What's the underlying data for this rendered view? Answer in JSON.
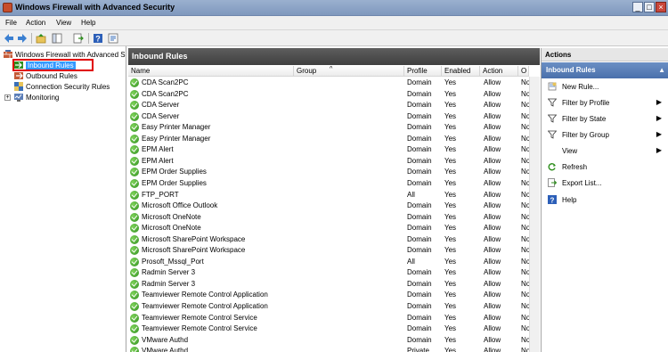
{
  "window": {
    "title": "Windows Firewall with Advanced Security"
  },
  "menu": [
    "File",
    "Action",
    "View",
    "Help"
  ],
  "toolbar": {
    "buttons": [
      "back-icon",
      "forward-icon",
      "up-folder-icon",
      "show-hide-tree-icon",
      "export-list-icon",
      "help-icon",
      "properties-icon"
    ]
  },
  "tree": {
    "root": "Windows Firewall with Advanced S",
    "items": [
      {
        "label": "Inbound Rules",
        "icon": "inbound-rules-icon",
        "selected": true
      },
      {
        "label": "Outbound Rules",
        "icon": "outbound-rules-icon"
      },
      {
        "label": "Connection Security Rules",
        "icon": "connection-security-icon"
      },
      {
        "label": "Monitoring",
        "icon": "monitoring-icon"
      }
    ]
  },
  "center": {
    "title": "Inbound Rules",
    "columns": [
      "Name",
      "Group",
      "Profile",
      "Enabled",
      "Action",
      "O"
    ],
    "rows": [
      {
        "name": "CDA Scan2PC",
        "profile": "Domain",
        "enabled": "Yes",
        "action": "Allow",
        "override": "No"
      },
      {
        "name": "CDA Scan2PC",
        "profile": "Domain",
        "enabled": "Yes",
        "action": "Allow",
        "override": "No"
      },
      {
        "name": "CDA Server",
        "profile": "Domain",
        "enabled": "Yes",
        "action": "Allow",
        "override": "No"
      },
      {
        "name": "CDA Server",
        "profile": "Domain",
        "enabled": "Yes",
        "action": "Allow",
        "override": "No"
      },
      {
        "name": "Easy Printer Manager",
        "profile": "Domain",
        "enabled": "Yes",
        "action": "Allow",
        "override": "No"
      },
      {
        "name": "Easy Printer Manager",
        "profile": "Domain",
        "enabled": "Yes",
        "action": "Allow",
        "override": "No"
      },
      {
        "name": "EPM Alert",
        "profile": "Domain",
        "enabled": "Yes",
        "action": "Allow",
        "override": "No"
      },
      {
        "name": "EPM Alert",
        "profile": "Domain",
        "enabled": "Yes",
        "action": "Allow",
        "override": "No"
      },
      {
        "name": "EPM Order Supplies",
        "profile": "Domain",
        "enabled": "Yes",
        "action": "Allow",
        "override": "No"
      },
      {
        "name": "EPM Order Supplies",
        "profile": "Domain",
        "enabled": "Yes",
        "action": "Allow",
        "override": "No"
      },
      {
        "name": "FTP_PORT",
        "profile": "All",
        "enabled": "Yes",
        "action": "Allow",
        "override": "No"
      },
      {
        "name": "Microsoft Office Outlook",
        "profile": "Domain",
        "enabled": "Yes",
        "action": "Allow",
        "override": "No"
      },
      {
        "name": "Microsoft OneNote",
        "profile": "Domain",
        "enabled": "Yes",
        "action": "Allow",
        "override": "No"
      },
      {
        "name": "Microsoft OneNote",
        "profile": "Domain",
        "enabled": "Yes",
        "action": "Allow",
        "override": "No"
      },
      {
        "name": "Microsoft SharePoint Workspace",
        "profile": "Domain",
        "enabled": "Yes",
        "action": "Allow",
        "override": "No"
      },
      {
        "name": "Microsoft SharePoint Workspace",
        "profile": "Domain",
        "enabled": "Yes",
        "action": "Allow",
        "override": "No"
      },
      {
        "name": "Prosoft_Mssql_Port",
        "profile": "All",
        "enabled": "Yes",
        "action": "Allow",
        "override": "No"
      },
      {
        "name": "Radmin Server 3",
        "profile": "Domain",
        "enabled": "Yes",
        "action": "Allow",
        "override": "No"
      },
      {
        "name": "Radmin Server 3",
        "profile": "Domain",
        "enabled": "Yes",
        "action": "Allow",
        "override": "No"
      },
      {
        "name": "Teamviewer Remote Control Application",
        "profile": "Domain",
        "enabled": "Yes",
        "action": "Allow",
        "override": "No"
      },
      {
        "name": "Teamviewer Remote Control Application",
        "profile": "Domain",
        "enabled": "Yes",
        "action": "Allow",
        "override": "No"
      },
      {
        "name": "Teamviewer Remote Control Service",
        "profile": "Domain",
        "enabled": "Yes",
        "action": "Allow",
        "override": "No"
      },
      {
        "name": "Teamviewer Remote Control Service",
        "profile": "Domain",
        "enabled": "Yes",
        "action": "Allow",
        "override": "No"
      },
      {
        "name": "VMware Authd",
        "profile": "Domain",
        "enabled": "Yes",
        "action": "Allow",
        "override": "No"
      },
      {
        "name": "VMware Authd",
        "profile": "Private",
        "enabled": "Yes",
        "action": "Allow",
        "override": "No"
      }
    ]
  },
  "actions": {
    "header": "Actions",
    "section": "Inbound Rules",
    "items": [
      {
        "label": "New Rule...",
        "icon": "new-rule-icon",
        "submenu": false
      },
      {
        "label": "Filter by Profile",
        "icon": "filter-icon",
        "submenu": true
      },
      {
        "label": "Filter by State",
        "icon": "filter-icon",
        "submenu": true
      },
      {
        "label": "Filter by Group",
        "icon": "filter-icon",
        "submenu": true
      },
      {
        "label": "View",
        "icon": "",
        "submenu": true
      },
      {
        "label": "Refresh",
        "icon": "refresh-icon",
        "submenu": false
      },
      {
        "label": "Export List...",
        "icon": "export-list-icon",
        "submenu": false
      },
      {
        "label": "Help",
        "icon": "help-icon",
        "submenu": false
      }
    ]
  },
  "colors": {
    "selection": "#3399ff",
    "header_dark": "#4a4a4a",
    "actions_blue": "#5a7fb8",
    "highlight_red": "#e00000",
    "ok_green": "#3fa52a"
  }
}
